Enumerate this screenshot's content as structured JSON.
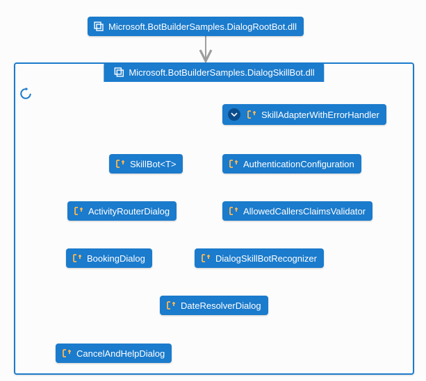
{
  "diagram": {
    "root": {
      "label": "Microsoft.BotBuilderSamples.DialogRootBot.dll"
    },
    "container": {
      "label": "Microsoft.BotBuilderSamples.DialogSkillBot.dll"
    },
    "nodes": {
      "skillAdapter": {
        "label": "SkillAdapterWithErrorHandler"
      },
      "skillBot": {
        "label": "SkillBot<T>"
      },
      "authConfig": {
        "label": "AuthenticationConfiguration"
      },
      "activityRouter": {
        "label": "ActivityRouterDialog"
      },
      "allowedCallers": {
        "label": "AllowedCallersClaimsValidator"
      },
      "bookingDialog": {
        "label": "BookingDialog"
      },
      "recognizer": {
        "label": "DialogSkillBotRecognizer"
      },
      "dateResolver": {
        "label": "DateResolverDialog"
      },
      "cancelHelp": {
        "label": "CancelAndHelpDialog"
      }
    }
  },
  "colors": {
    "nodeFill": "#1b7bcc",
    "edgeGray": "#9d9d9d",
    "edgeMagenta": "#e815e8",
    "edgeGreen": "#1fb41f"
  }
}
